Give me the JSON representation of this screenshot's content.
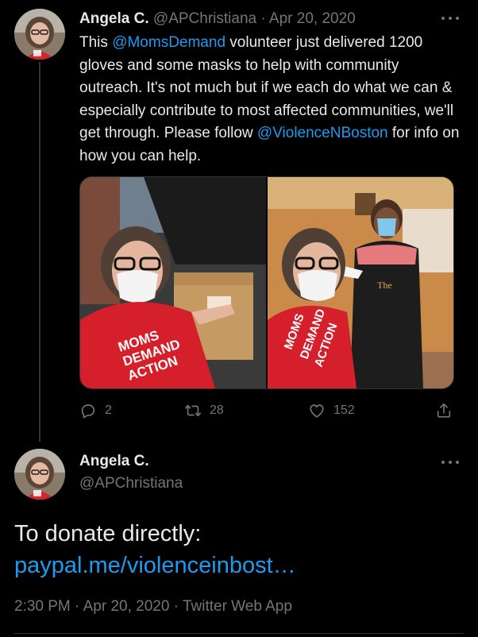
{
  "tweet1": {
    "name": "Angela C.",
    "handle": "@APChristiana",
    "separator": "·",
    "date": "Apr 20, 2020",
    "text_part1": "This ",
    "mention1": "@MomsDemand",
    "text_part2": " volunteer just delivered 1200 gloves and some masks to help with community outreach. It's not much but if we each do what we can & especially contribute to most affected communities, we'll get through. Please follow ",
    "mention2": "@ViolenceNBoston",
    "text_part3": " for info on how you can help.",
    "stats": {
      "replies": "2",
      "retweets": "28",
      "likes": "152"
    }
  },
  "tweet2": {
    "name": "Angela C.",
    "handle": "@APChristiana",
    "text_line1": "To donate directly:",
    "link": "paypal.me/violenceinbost…",
    "meta": "2:30 PM · Apr 20, 2020 · Twitter Web App"
  },
  "colors": {
    "background": "#000000",
    "text": "#e7e9ea",
    "muted": "#71767b",
    "link": "#1d9bf0"
  },
  "icons": [
    "more-icon",
    "reply-icon",
    "retweet-icon",
    "like-icon",
    "share-icon"
  ]
}
